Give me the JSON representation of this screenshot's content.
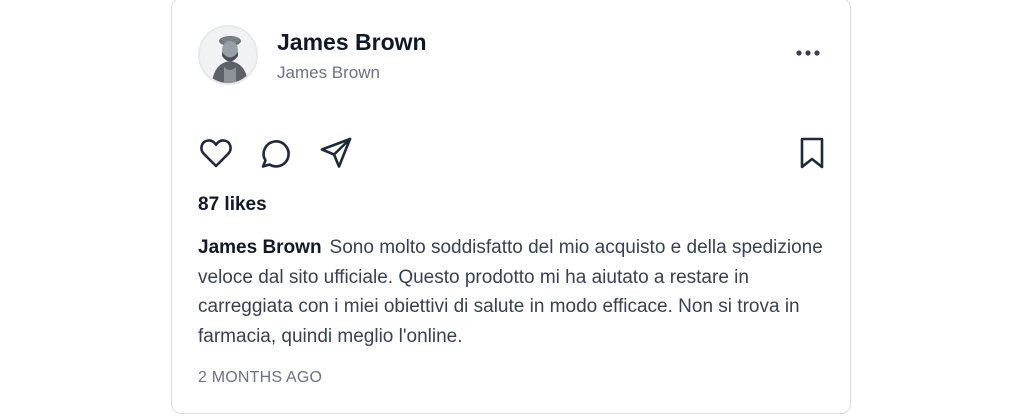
{
  "post": {
    "author": {
      "display_name": "James Brown",
      "username": "James Brown",
      "avatar_icon": "user-photo-avatar"
    },
    "more_icon": "more-horizontal-icon",
    "actions": {
      "like_icon": "heart-icon",
      "comment_icon": "comment-icon",
      "share_icon": "send-icon",
      "save_icon": "bookmark-icon"
    },
    "likes_text": "87 likes",
    "caption": {
      "author": "James Brown",
      "text": "Sono molto soddisfatto del mio acquisto e della spedizione veloce dal sito ufficiale. Questo prodotto mi ha aiutato a restare in carreggiata con i miei obiettivi di salute in modo efficace. Non si trova in farmacia, quindi meglio l'online."
    },
    "timestamp": "2 MONTHS AGO"
  },
  "colors": {
    "text_primary": "#111827",
    "text_secondary": "#6b7280",
    "border": "#dcdde1"
  }
}
